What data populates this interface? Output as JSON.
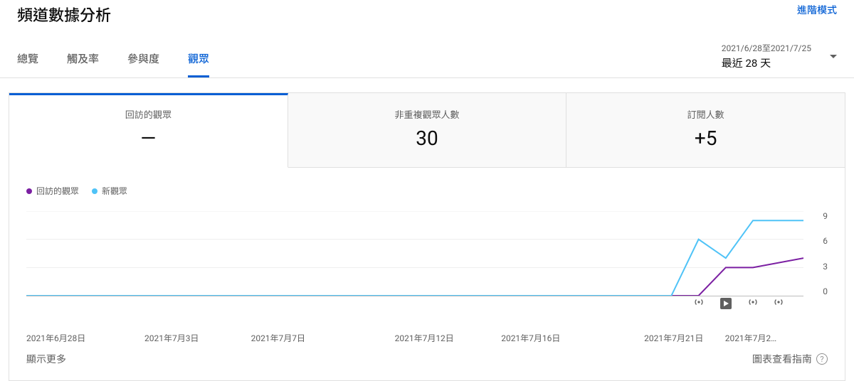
{
  "header": {
    "title": "頻道數據分析",
    "advanced": "進階模式"
  },
  "tabs": [
    {
      "label": "總覽"
    },
    {
      "label": "觸及率"
    },
    {
      "label": "參與度"
    },
    {
      "label": "觀眾",
      "active": true
    }
  ],
  "period": {
    "range": "2021/6/28至2021/7/25",
    "label": "最近 28 天"
  },
  "metric_tabs": [
    {
      "title": "回訪的觀眾",
      "value": "—",
      "active": true
    },
    {
      "title": "非重複觀眾人數",
      "value": "30"
    },
    {
      "title": "訂閱人數",
      "value": "+5"
    }
  ],
  "legend": [
    {
      "color": "purple",
      "label": "回訪的觀眾"
    },
    {
      "color": "blue",
      "label": "新觀眾"
    }
  ],
  "footer": {
    "more": "顯示更多",
    "guide": "圖表查看指南"
  },
  "chart_data": {
    "type": "line",
    "ylim": [
      0,
      9
    ],
    "yticks": [
      9,
      6,
      3,
      0
    ],
    "x_labels": [
      "2021年6月28日",
      "2021年7月3日",
      "2021年7月7日",
      "2021年7月12日",
      "2021年7月16日",
      "2021年7月21日",
      "2021年7月2…"
    ],
    "x_pos_pct": [
      0,
      15.2,
      28.9,
      47.4,
      61.1,
      79.5,
      89.9
    ],
    "series": [
      {
        "name": "回訪的觀眾",
        "color": "#7b1fa2",
        "points": [
          {
            "xpct": 0,
            "y": 0
          },
          {
            "xpct": 86.5,
            "y": 0
          },
          {
            "xpct": 90.0,
            "y": 3
          },
          {
            "xpct": 93.5,
            "y": 3
          },
          {
            "xpct": 100,
            "y": 4
          }
        ]
      },
      {
        "name": "新觀眾",
        "color": "#4fc3f7",
        "points": [
          {
            "xpct": 0,
            "y": 0
          },
          {
            "xpct": 83.0,
            "y": 0
          },
          {
            "xpct": 86.5,
            "y": 6
          },
          {
            "xpct": 90.0,
            "y": 4
          },
          {
            "xpct": 93.5,
            "y": 8
          },
          {
            "xpct": 100,
            "y": 8
          }
        ]
      }
    ],
    "markers": [
      {
        "type": "broadcast",
        "xpct": 86.5
      },
      {
        "type": "play",
        "xpct": 90.0
      },
      {
        "type": "broadcast",
        "xpct": 93.5
      },
      {
        "type": "broadcast",
        "xpct": 96.8
      }
    ]
  }
}
